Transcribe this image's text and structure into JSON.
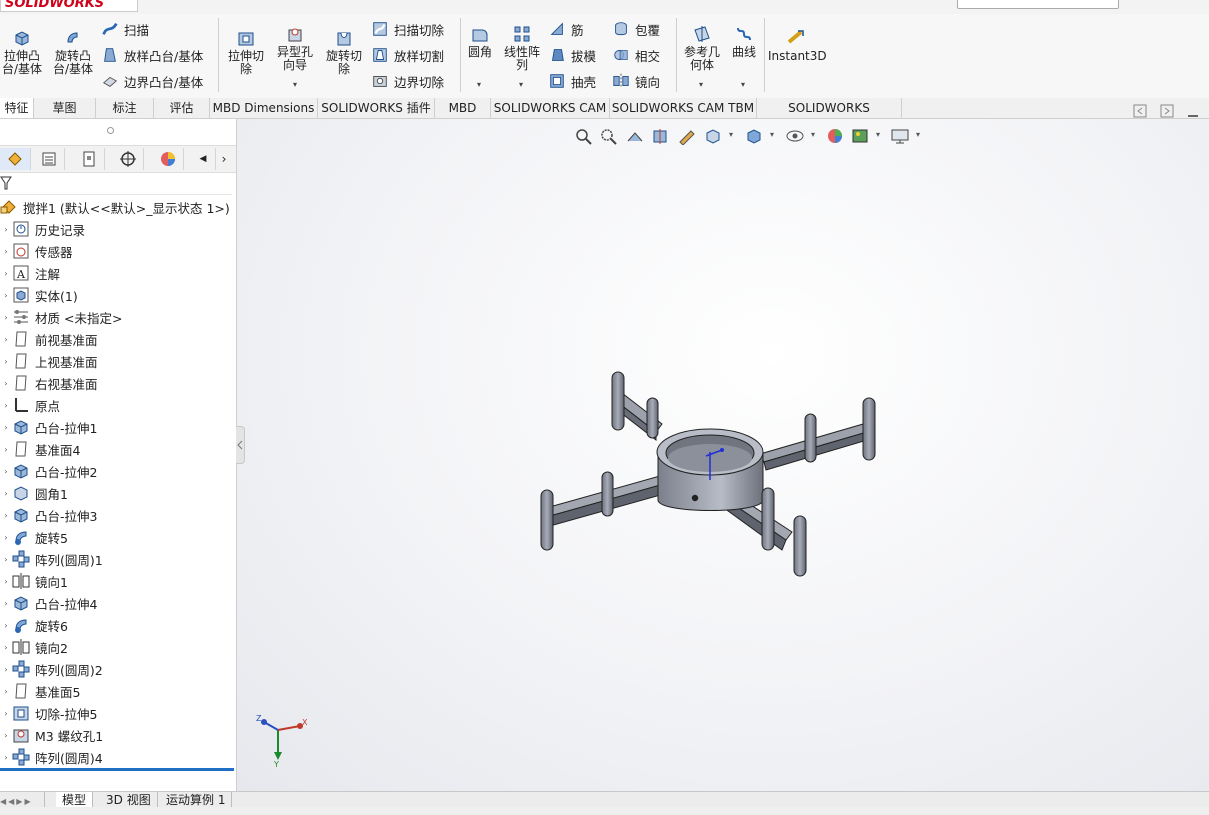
{
  "app": {
    "logo_text": "SOLIDWORKS"
  },
  "ribbon": {
    "extrude_boss": "拉伸凸\n台/基体",
    "revolve_boss": "旋转凸\n台/基体",
    "sweep": "扫描",
    "loft_boss": "放样凸台/基体",
    "boundary_boss": "边界凸台/基体",
    "extrude_cut": "拉伸切\n除",
    "hole_wizard": "异型孔\n向导",
    "revolve_cut": "旋转切\n除",
    "sweep_cut": "扫描切除",
    "loft_cut": "放样切割",
    "boundary_cut": "边界切除",
    "fillet": "圆角",
    "linear_pattern": "线性阵\n列",
    "rib": "筋",
    "draft": "拔模",
    "shell": "抽壳",
    "wrap": "包覆",
    "intersect": "相交",
    "mirror": "镜向",
    "ref_geometry": "参考几\n何体",
    "curves": "曲线",
    "instant3d": "Instant3D"
  },
  "tabs": [
    "特征",
    "草图",
    "标注",
    "评估",
    "MBD Dimensions",
    "SOLIDWORKS 插件",
    "MBD",
    "SOLIDWORKS CAM",
    "SOLIDWORKS CAM TBM",
    "SOLIDWORKS Inspection"
  ],
  "tree": {
    "root": "搅拌1  (默认<<默认>_显示状态 1>)",
    "items": [
      {
        "label": "历史记录",
        "icon": "history-icon"
      },
      {
        "label": "传感器",
        "icon": "sensor-icon"
      },
      {
        "label": "注解",
        "icon": "annotation-icon"
      },
      {
        "label": "实体(1)",
        "icon": "solid-bodies-icon"
      },
      {
        "label": "材质 <未指定>",
        "icon": "material-icon"
      },
      {
        "label": "前视基准面",
        "icon": "plane-icon"
      },
      {
        "label": "上视基准面",
        "icon": "plane-icon"
      },
      {
        "label": "右视基准面",
        "icon": "plane-icon"
      },
      {
        "label": "原点",
        "icon": "origin-icon"
      },
      {
        "label": "凸台-拉伸1",
        "icon": "extrude-icon"
      },
      {
        "label": "基准面4",
        "icon": "plane-icon"
      },
      {
        "label": "凸台-拉伸2",
        "icon": "extrude-icon"
      },
      {
        "label": "圆角1",
        "icon": "fillet-icon"
      },
      {
        "label": "凸台-拉伸3",
        "icon": "extrude-icon"
      },
      {
        "label": "旋转5",
        "icon": "revolve-icon"
      },
      {
        "label": "阵列(圆周)1",
        "icon": "circular-pattern-icon"
      },
      {
        "label": "镜向1",
        "icon": "mirror-icon"
      },
      {
        "label": "凸台-拉伸4",
        "icon": "extrude-icon"
      },
      {
        "label": "旋转6",
        "icon": "revolve-icon"
      },
      {
        "label": "镜向2",
        "icon": "mirror-icon"
      },
      {
        "label": "阵列(圆周)2",
        "icon": "circular-pattern-icon"
      },
      {
        "label": "基准面5",
        "icon": "plane-icon"
      },
      {
        "label": "切除-拉伸5",
        "icon": "cut-extrude-icon"
      },
      {
        "label": "M3 螺纹孔1",
        "icon": "hole-icon"
      },
      {
        "label": "阵列(圆周)4",
        "icon": "circular-pattern-icon"
      }
    ]
  },
  "bottom_tabs": [
    "模型",
    "3D 视图",
    "运动算例 1"
  ],
  "triad": {
    "x": "X",
    "y": "Y",
    "z": "Z"
  }
}
